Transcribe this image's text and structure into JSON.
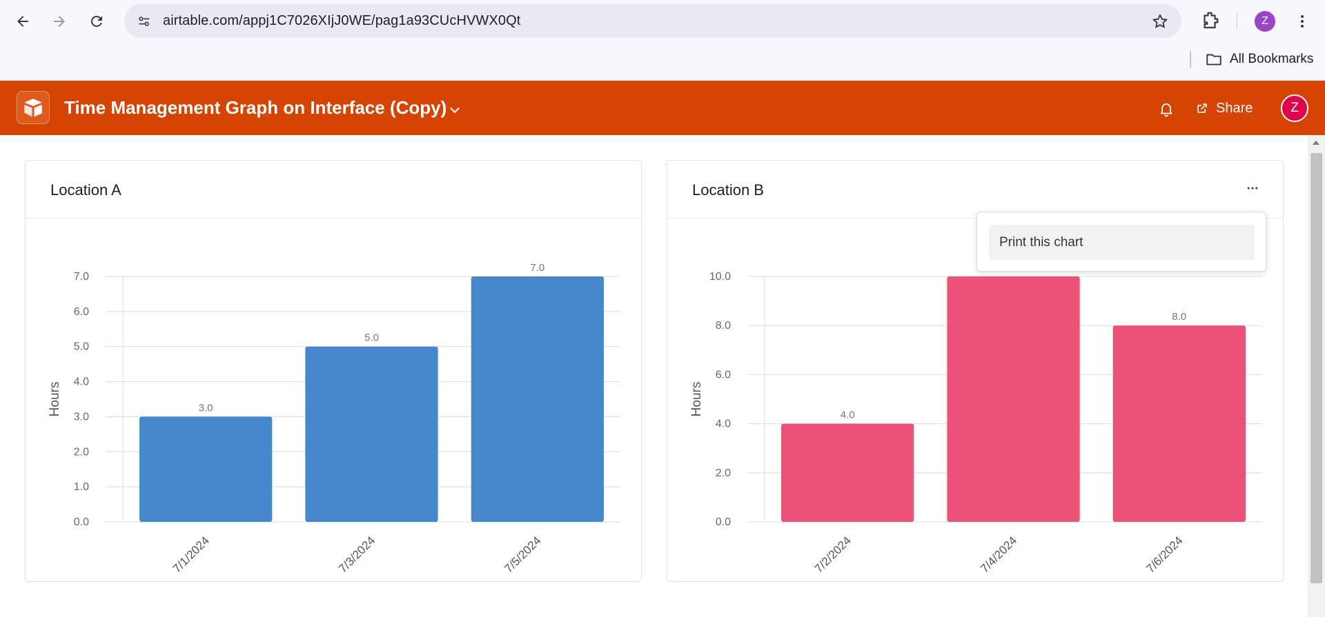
{
  "browser": {
    "url": "airtable.com/appj1C7026XIjJ0WE/pag1a93CUcHVWX0Qt",
    "profile_initial": "Z",
    "bookmarks_label": "All Bookmarks"
  },
  "app": {
    "title": "Time Management Graph on Interface (Copy)",
    "share_label": "Share",
    "user_initial": "Z",
    "header_color": "#d54402"
  },
  "menu": {
    "print_label": "Print this chart"
  },
  "chart_data": [
    {
      "type": "bar",
      "title": "Location A",
      "ylabel": "Hours",
      "xlabel": "",
      "categories": [
        "7/1/2024",
        "7/3/2024",
        "7/5/2024"
      ],
      "values": [
        3.0,
        5.0,
        7.0
      ],
      "value_labels": [
        "3.0",
        "5.0",
        "7.0"
      ],
      "yticks": [
        "0.0",
        "1.0",
        "2.0",
        "3.0",
        "4.0",
        "5.0",
        "6.0",
        "7.0"
      ],
      "ylim": [
        0,
        7
      ],
      "color": "#4788cc",
      "grid": true,
      "legend": "none"
    },
    {
      "type": "bar",
      "title": "Location B",
      "ylabel": "Hours",
      "xlabel": "",
      "categories": [
        "7/2/2024",
        "7/4/2024",
        "7/6/2024"
      ],
      "values": [
        4.0,
        10.0,
        8.0
      ],
      "value_labels": [
        "4.0",
        "10.0",
        "8.0"
      ],
      "yticks": [
        "0.0",
        "2.0",
        "4.0",
        "6.0",
        "8.0",
        "10.0"
      ],
      "ylim": [
        0,
        10
      ],
      "color": "#ec5278",
      "grid": true,
      "legend": "none"
    }
  ]
}
